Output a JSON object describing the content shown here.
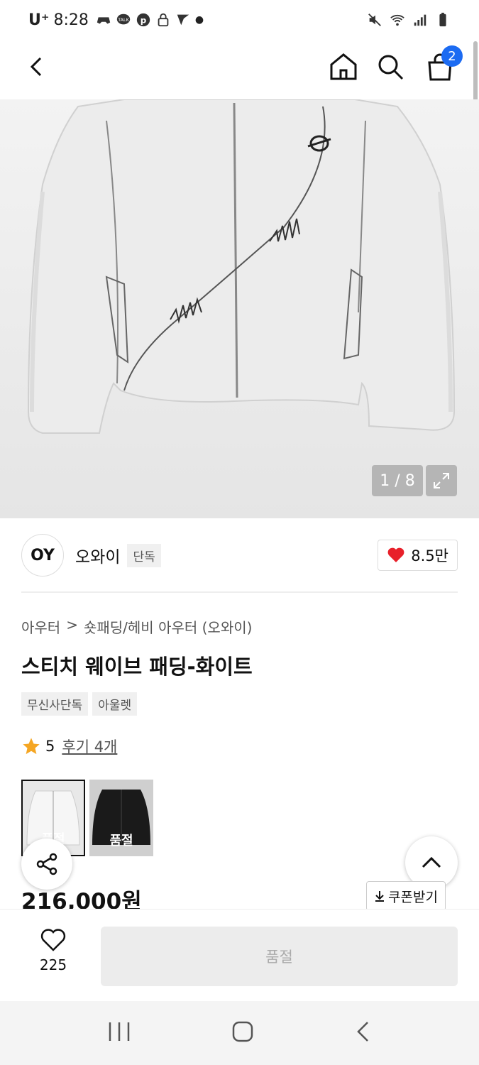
{
  "status_bar": {
    "carrier": "U⁺",
    "time": "8:28"
  },
  "appbar": {
    "cart_count": "2"
  },
  "hero": {
    "image_counter": "1 / 8"
  },
  "brand": {
    "logo_text": "OY",
    "name": "오와이",
    "tag": "단독",
    "likes": "8.5만"
  },
  "breadcrumb": {
    "level1": "아우터",
    "separator": ">",
    "level2": "숏패딩/헤비 아우터 (오와이)"
  },
  "product": {
    "title": "스티치 웨이브 패딩-화이트",
    "tags": [
      "무신사단독",
      "아울렛"
    ],
    "rating": "5",
    "review_link": "후기 4개",
    "price": "216,000원"
  },
  "thumbnails": [
    {
      "label": "품절",
      "color": "white"
    },
    {
      "label": "품절",
      "color": "black"
    }
  ],
  "coupon": {
    "label": "쿠폰받기"
  },
  "bottom": {
    "wish_count": "225",
    "buy_label": "품절"
  },
  "colors": {
    "accent": "#1c6bf2",
    "heart": "#e8202a",
    "star": "#f5a623"
  }
}
